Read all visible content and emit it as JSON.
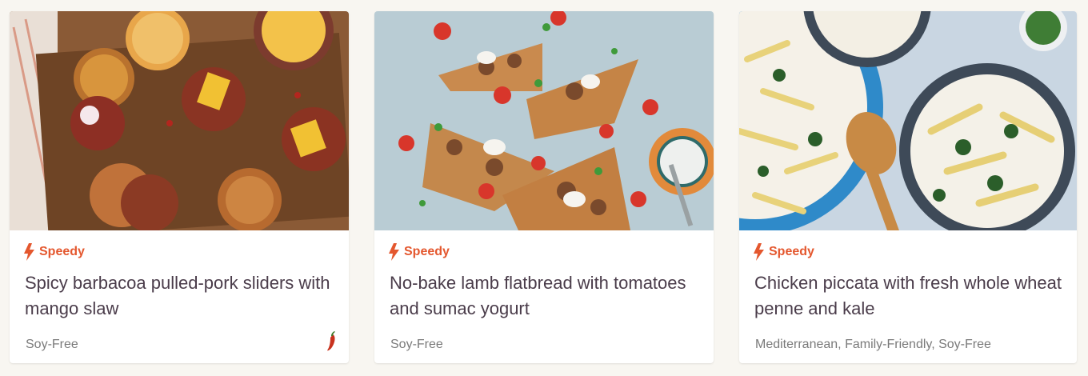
{
  "colors": {
    "accent": "#e4572e",
    "title": "#4a3c4a",
    "tags": "#7a7a7a",
    "page_background": "#f8f6f1",
    "card_background": "#ffffff"
  },
  "recipes": [
    {
      "image": "sliders-photo",
      "badge_icon": "bolt-icon",
      "badge": "Speedy",
      "title": "Spicy barbacoa pulled-pork sliders with mango slaw",
      "tags": "Soy-Free",
      "extra_icon": "chili-pepper-icon"
    },
    {
      "image": "flatbread-photo",
      "badge_icon": "bolt-icon",
      "badge": "Speedy",
      "title": "No-bake lamb flatbread with tomatoes and sumac yogurt",
      "tags": "Soy-Free"
    },
    {
      "image": "piccata-photo",
      "badge_icon": "bolt-icon",
      "badge": "Speedy",
      "title": "Chicken piccata with fresh whole wheat penne and kale",
      "tags": "Mediterranean, Family-Friendly, Soy-Free"
    }
  ]
}
